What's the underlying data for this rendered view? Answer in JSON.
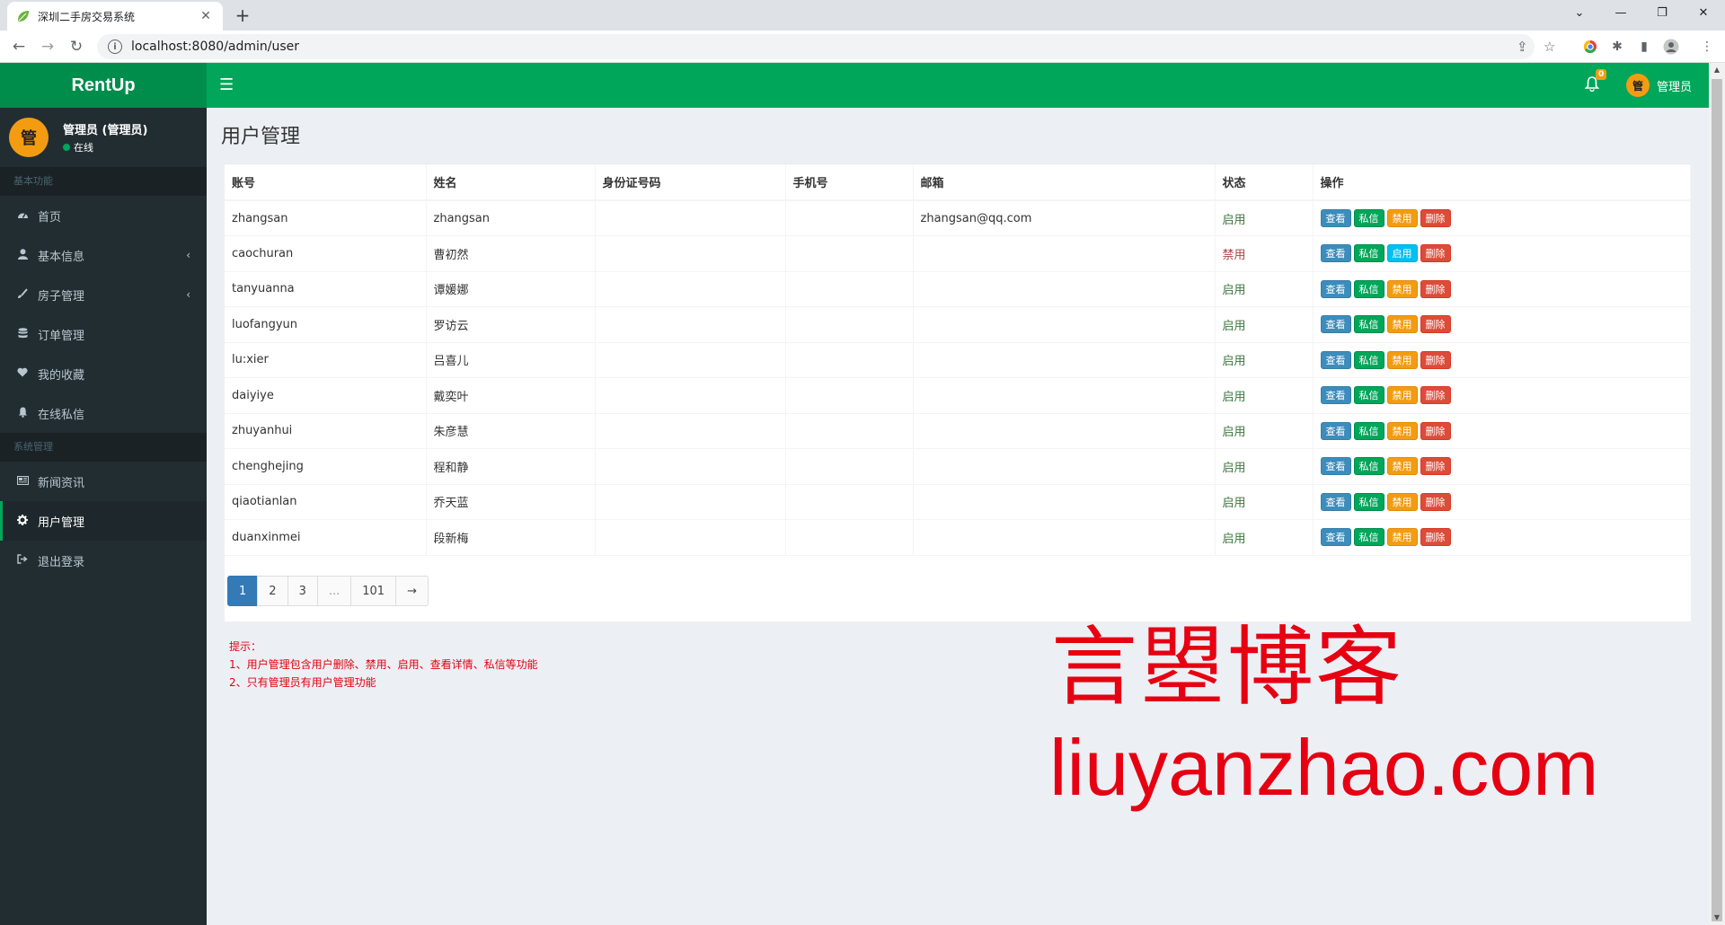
{
  "browser": {
    "tab_title": "深圳二手房交易系统",
    "url": "localhost:8080/admin/user"
  },
  "header": {
    "logo": "RentUp",
    "notification_count": "0",
    "avatar_char": "管",
    "user_label": "管理员",
    "brand_color": "#00a65a"
  },
  "sidebar": {
    "avatar_char": "管",
    "user_name": "管理员 (管理员)",
    "status": "在线",
    "sections": [
      {
        "header": "基本功能",
        "items": [
          {
            "label": "首页",
            "icon": "dashboard-icon"
          },
          {
            "label": "基本信息",
            "icon": "user-icon",
            "caret": "‹"
          },
          {
            "label": "房子管理",
            "icon": "brush-icon",
            "caret": "‹"
          },
          {
            "label": "订单管理",
            "icon": "database-icon"
          },
          {
            "label": "我的收藏",
            "icon": "heart-icon"
          },
          {
            "label": "在线私信",
            "icon": "bell-icon"
          }
        ]
      },
      {
        "header": "系统管理",
        "items": [
          {
            "label": "新闻资讯",
            "icon": "newspaper-icon"
          },
          {
            "label": "用户管理",
            "icon": "gear-icon"
          },
          {
            "label": "退出登录",
            "icon": "sign-out-icon"
          }
        ]
      }
    ]
  },
  "main": {
    "title": "用户管理",
    "table": {
      "headers": [
        "账号",
        "姓名",
        "身份证号码",
        "手机号",
        "邮箱",
        "状态",
        "操作"
      ],
      "rows": [
        {
          "account": "zhangsan",
          "name": "zhangsan",
          "id_no": "",
          "phone": "",
          "email": "zhangsan@qq.com",
          "status": "启用",
          "toggle": "禁用"
        },
        {
          "account": "caochuran",
          "name": "曹初然",
          "id_no": "",
          "phone": "",
          "email": "",
          "status": "禁用",
          "toggle": "启用"
        },
        {
          "account": "tanyuanna",
          "name": "谭媛娜",
          "id_no": "",
          "phone": "",
          "email": "",
          "status": "启用",
          "toggle": "禁用"
        },
        {
          "account": "luofangyun",
          "name": "罗访云",
          "id_no": "",
          "phone": "",
          "email": "",
          "status": "启用",
          "toggle": "禁用"
        },
        {
          "account": "lu:xier",
          "name": "吕喜儿",
          "id_no": "",
          "phone": "",
          "email": "",
          "status": "启用",
          "toggle": "禁用"
        },
        {
          "account": "daiyiye",
          "name": "戴奕叶",
          "id_no": "",
          "phone": "",
          "email": "",
          "status": "启用",
          "toggle": "禁用"
        },
        {
          "account": "zhuyanhui",
          "name": "朱彦慧",
          "id_no": "",
          "phone": "",
          "email": "",
          "status": "启用",
          "toggle": "禁用"
        },
        {
          "account": "chenghejing",
          "name": "程和静",
          "id_no": "",
          "phone": "",
          "email": "",
          "status": "启用",
          "toggle": "禁用"
        },
        {
          "account": "qiaotianlan",
          "name": "乔天蓝",
          "id_no": "",
          "phone": "",
          "email": "",
          "status": "启用",
          "toggle": "禁用"
        },
        {
          "account": "duanxinmei",
          "name": "段新梅",
          "id_no": "",
          "phone": "",
          "email": "",
          "status": "启用",
          "toggle": "禁用"
        }
      ],
      "actions": {
        "view": "查看",
        "message": "私信",
        "delete": "删除"
      }
    },
    "pagination": [
      "1",
      "2",
      "3",
      "...",
      "101",
      "→"
    ],
    "tips": [
      "提示：",
      "1、用户管理包含用户删除、禁用、启用、查看详情、私信等功能",
      "2、只有管理员有用户管理功能"
    ]
  },
  "watermark": {
    "cn": "言曌博客",
    "en": "liuyanzhao.com"
  }
}
